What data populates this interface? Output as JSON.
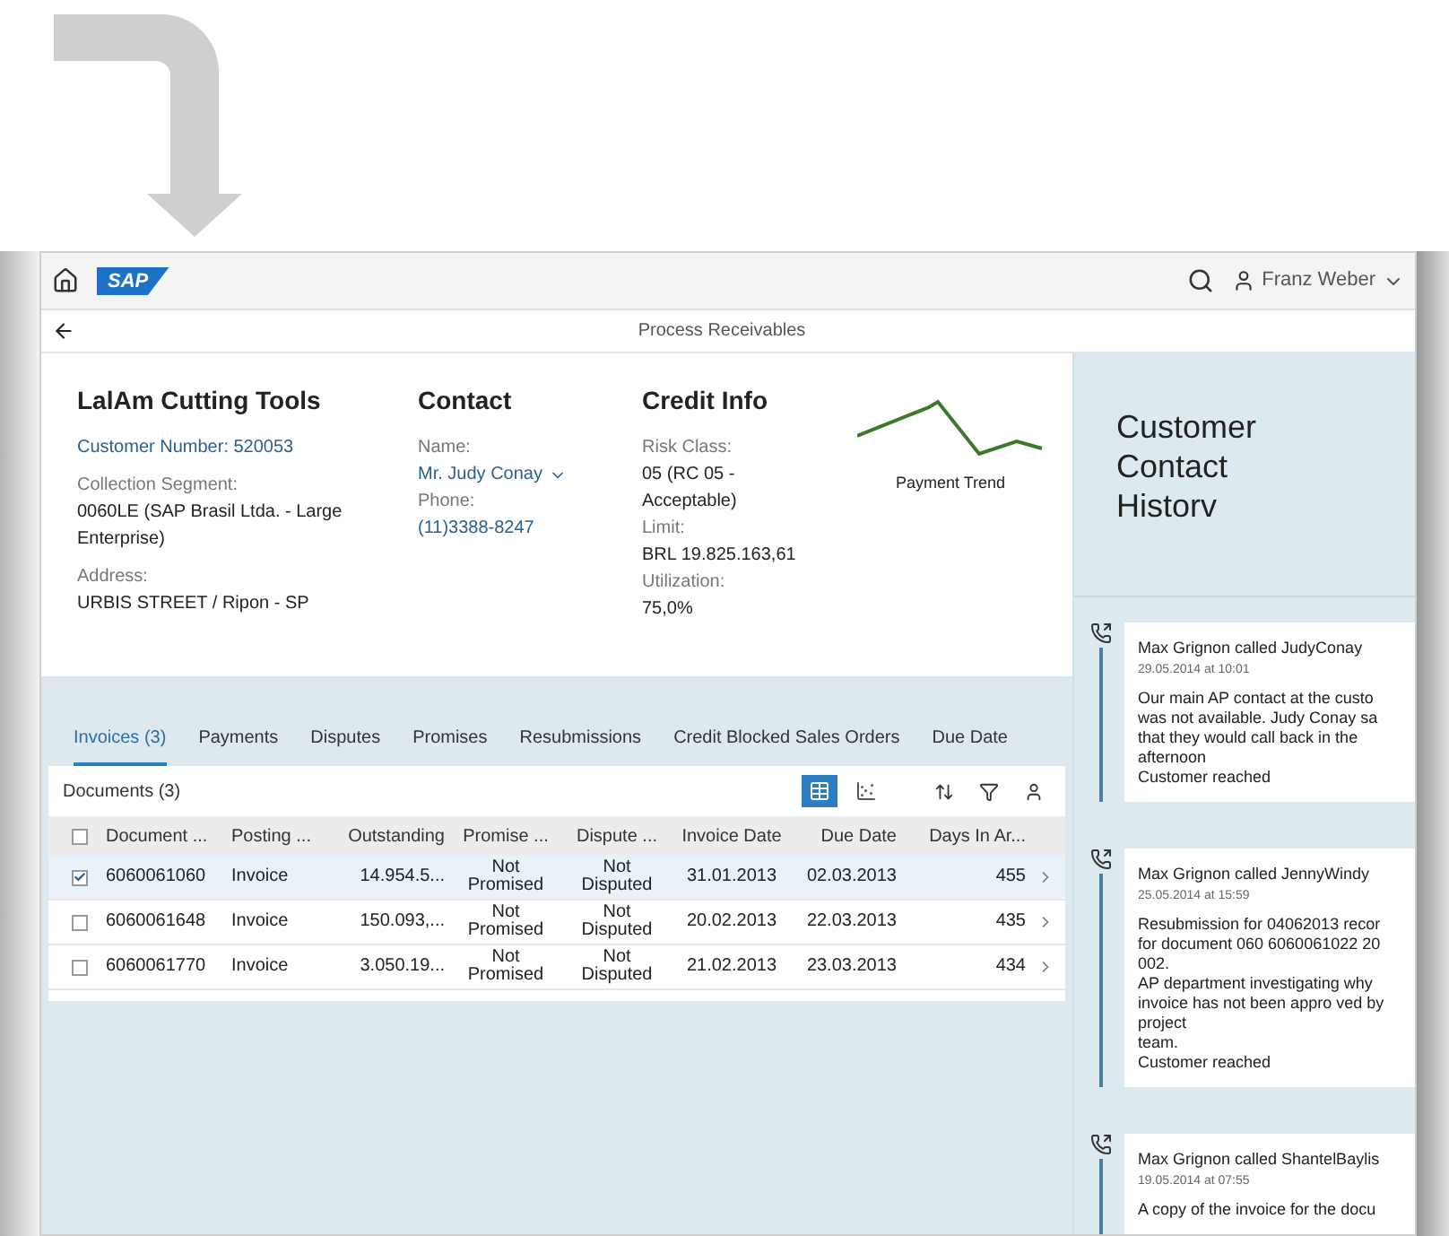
{
  "shell": {
    "logo": "SAP",
    "user": "Franz Weber"
  },
  "page_title": "Process Receivables",
  "customer": {
    "name": "LalAm Cutting Tools",
    "number": "Customer Number: 520053",
    "fields": [
      {
        "label": "Collection Segment:",
        "value": "0060LE (SAP Brasil Ltda. - Large Enterprise)"
      },
      {
        "label": "Address:",
        "value": "URBIS STREET / Ripon - SP"
      }
    ]
  },
  "contact": {
    "title": "Contact",
    "name_label": "Name:",
    "name": "Mr. Judy Conay",
    "phone_label": "Phone:",
    "phone": "(11)3388-8247"
  },
  "credit": {
    "title": "Credit Info",
    "fields": [
      {
        "label": "Risk Class:",
        "value": "05 (RC 05 - Acceptable)"
      },
      {
        "label": "Limit:",
        "value": "BRL 19.825.163,61"
      },
      {
        "label": "Utilization:",
        "value": "75,0%"
      }
    ]
  },
  "trend": {
    "label": "Payment Trend"
  },
  "tabs": [
    {
      "label": "Invoices (3)",
      "selected": true
    },
    {
      "label": "Payments",
      "selected": false
    },
    {
      "label": "Disputes",
      "selected": false
    },
    {
      "label": "Promises",
      "selected": false
    },
    {
      "label": "Resubmissions",
      "selected": false
    },
    {
      "label": "Credit Blocked Sales Orders",
      "selected": false
    },
    {
      "label": "Due Date",
      "selected": false
    }
  ],
  "table": {
    "title": "Documents (3)",
    "select_all": false,
    "views": [
      {
        "kind": "table",
        "selected": true
      },
      {
        "kind": "chart",
        "selected": false
      }
    ],
    "columns": [
      "Document ...",
      "Posting ...",
      "Outstanding",
      "Promise ...",
      "Dispute ...",
      "Invoice Date",
      "Due Date",
      "Days In Ar..."
    ],
    "rows": [
      {
        "selected": true,
        "cells": [
          "6060061060",
          "Invoice",
          "14.954.5...",
          "Not Promised",
          "Not Disputed",
          "31.01.2013",
          "02.03.2013",
          "455"
        ]
      },
      {
        "selected": false,
        "cells": [
          "6060061648",
          "Invoice",
          "150.093,...",
          "Not Promised",
          "Not Disputed",
          "20.02.2013",
          "22.03.2013",
          "435"
        ]
      },
      {
        "selected": false,
        "cells": [
          "6060061770",
          "Invoice",
          "3.050.19...",
          "Not Promised",
          "Not Disputed",
          "21.02.2013",
          "23.03.2013",
          "434"
        ]
      }
    ]
  },
  "history": {
    "title": "Customer Contact Historv",
    "entries": [
      {
        "title": "Max Grignon called JudyConay",
        "date": "29.05.2014 at 10:01",
        "lines": [
          "Our main AP contact at the custo",
          "was not available. Judy Conay sa",
          "that they would call back in the",
          "afternoon",
          "Customer reached"
        ]
      },
      {
        "title": "Max Grignon called JennyWindy",
        "date": "25.05.2014 at 15:59",
        "lines": [
          "Resubmission for 04062013 recor",
          "for document 060 6060061022 20",
          "002.",
          "AP department investigating why",
          "invoice has not been appro ved by",
          "project",
          "team.",
          "Customer reached"
        ]
      },
      {
        "title": "Max Grignon called ShantelBaylis",
        "date": "19.05.2014 at 07:55",
        "lines": [
          "A copy of the invoice for the docu"
        ]
      }
    ]
  }
}
